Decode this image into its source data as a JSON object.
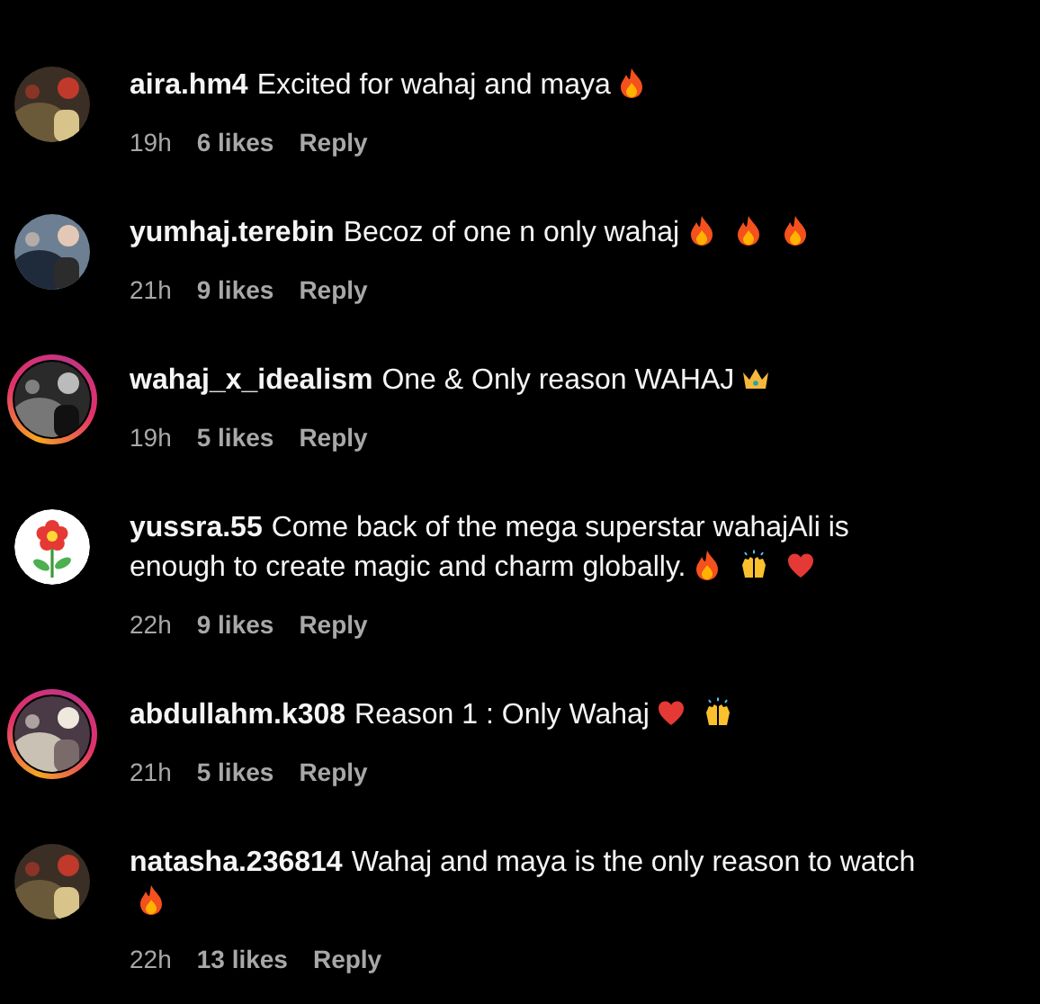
{
  "comments": [
    {
      "username": "aira.hm4",
      "avatar": {
        "kind": "picture",
        "story_ring": false
      },
      "text": "Excited for wahaj and maya",
      "emojis": [
        {
          "kind": "fire"
        }
      ],
      "time": "19h",
      "likes": "6 likes",
      "reply": "Reply"
    },
    {
      "username": "yumhaj.terebin",
      "avatar": {
        "kind": "picture",
        "story_ring": false
      },
      "text": "Becoz of one n only wahaj",
      "emojis": [
        {
          "kind": "fire"
        },
        {
          "kind": "fire"
        },
        {
          "kind": "fire"
        }
      ],
      "time": "21h",
      "likes": "9 likes",
      "reply": "Reply"
    },
    {
      "username": "wahaj_x_idealism",
      "avatar": {
        "kind": "picture",
        "story_ring": true
      },
      "text": "One & Only reason WAHAJ",
      "emojis": [
        {
          "kind": "crown"
        }
      ],
      "time": "19h",
      "likes": "5 likes",
      "reply": "Reply"
    },
    {
      "username": "yussra.55",
      "avatar": {
        "kind": "flower",
        "story_ring": false
      },
      "text": "Come back of the mega superstar wahajAli is enough to create magic and charm globally.",
      "emojis": [
        {
          "kind": "fire"
        },
        {
          "kind": "hands"
        },
        {
          "kind": "heart"
        }
      ],
      "time": "22h",
      "likes": "9 likes",
      "reply": "Reply"
    },
    {
      "username": "abdullahm.k308",
      "avatar": {
        "kind": "picture",
        "story_ring": true
      },
      "text": "Reason 1 : Only Wahaj",
      "emojis": [
        {
          "kind": "heart"
        },
        {
          "kind": "hands"
        }
      ],
      "time": "21h",
      "likes": "5 likes",
      "reply": "Reply"
    },
    {
      "username": "natasha.236814",
      "avatar": {
        "kind": "picture",
        "story_ring": false
      },
      "text": "Wahaj and maya is the only reason to watch",
      "emojis": [
        {
          "kind": "fire"
        }
      ],
      "time": "22h",
      "likes": "13 likes",
      "reply": "Reply"
    }
  ]
}
